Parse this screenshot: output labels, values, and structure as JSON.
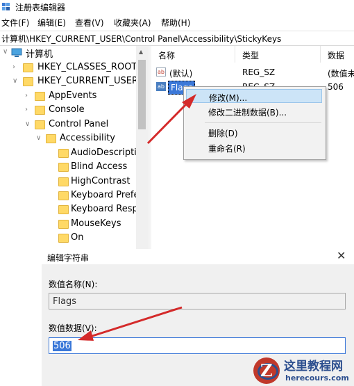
{
  "window": {
    "title": "注册表编辑器"
  },
  "menu": [
    "文件(F)",
    "编辑(E)",
    "查看(V)",
    "收藏夹(A)",
    "帮助(H)"
  ],
  "address": "计算机\\HKEY_CURRENT_USER\\Control Panel\\Accessibility\\StickyKeys",
  "tree": {
    "root": "计算机",
    "items": [
      "HKEY_CLASSES_ROOT",
      "HKEY_CURRENT_USER",
      "AppEvents",
      "Console",
      "Control Panel",
      "Accessibility",
      "AudioDescriptic",
      "Blind Access",
      "HighContrast",
      "Keyboard Prefe",
      "Keyboard Resp",
      "MouseKeys",
      "On"
    ]
  },
  "list": {
    "headers": [
      "名称",
      "类型",
      "数据"
    ],
    "rows": [
      {
        "name": "(默认)",
        "type": "REG_SZ",
        "data": "(数值未"
      },
      {
        "name": "Flags",
        "type": "REG_SZ",
        "data": "506"
      }
    ]
  },
  "context_menu": {
    "items": [
      "修改(M)...",
      "修改二进制数据(B)...",
      "删除(D)",
      "重命名(R)"
    ],
    "highlighted": "修改(M)..."
  },
  "dialog": {
    "title": "编辑字符串",
    "name_label": "数值名称(N):",
    "name_value": "Flags",
    "data_label": "数值数据(V):",
    "data_value": "506"
  },
  "watermark": {
    "name": "这里教程网",
    "url": "herecours.com"
  },
  "colors": {
    "arrow": "#d42a2a",
    "selection": "#3b78d8",
    "folder": "#ffd966",
    "highlight": "#cce4f7"
  }
}
